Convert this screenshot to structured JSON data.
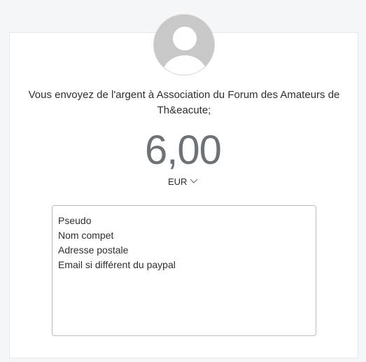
{
  "recipient": {
    "text": "Vous envoyez de l'argent à Association du Forum des Amateurs de Th&eacute;"
  },
  "payment": {
    "amount": "6,00",
    "currency": "EUR"
  },
  "note": {
    "lines": [
      "Pseudo",
      "Nom compet",
      "Adresse postale",
      "Email si différent du paypal"
    ]
  },
  "icons": {
    "avatar": "default-user-avatar-icon",
    "currency_toggle": "chevron-down-icon"
  },
  "colors": {
    "background": "#f5f6f8",
    "card": "#ffffff",
    "amount_text": "#6c7378",
    "avatar_bg": "#c8c8c8"
  }
}
